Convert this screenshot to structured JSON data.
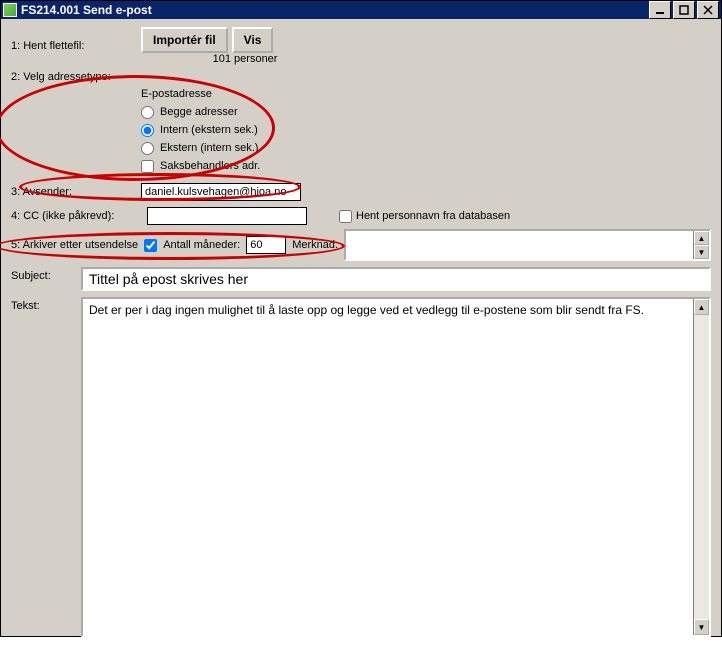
{
  "window": {
    "title": "FS214.001 Send e-post"
  },
  "row1": {
    "label": "1: Hent flettefil:",
    "import_btn": "Importér fil",
    "vis_btn": "Vis",
    "person_count": "101 personer"
  },
  "row2": {
    "label": "2: Velg adressetype:",
    "header": "E-postadresse",
    "opt_begge": "Begge adresser",
    "opt_intern": "Intern (ekstern sek.)",
    "opt_ekstern": "Ekstern (intern sek.)",
    "chk_saks": "Saksbehandlers adr."
  },
  "row3": {
    "label": "3: Avsender:",
    "value": "daniel.kulsvehagen@hioa.no"
  },
  "row4": {
    "label": "4: CC (ikke påkrevd):",
    "value": "",
    "chk_hent": "Hent personnavn fra databasen"
  },
  "row5": {
    "label": "5: Arkiver etter utsendelse",
    "months_label": "Antall måneder:",
    "months_value": "60",
    "merknad_label": "Merknad:",
    "merknad_value": ""
  },
  "subject": {
    "label": "Subject:",
    "value": "Tittel på epost skrives her"
  },
  "body": {
    "label": "Tekst:",
    "value": "Det er per i dag ingen mulighet til å laste opp og legge ved et vedlegg til e-postene som blir sendt fra FS."
  }
}
